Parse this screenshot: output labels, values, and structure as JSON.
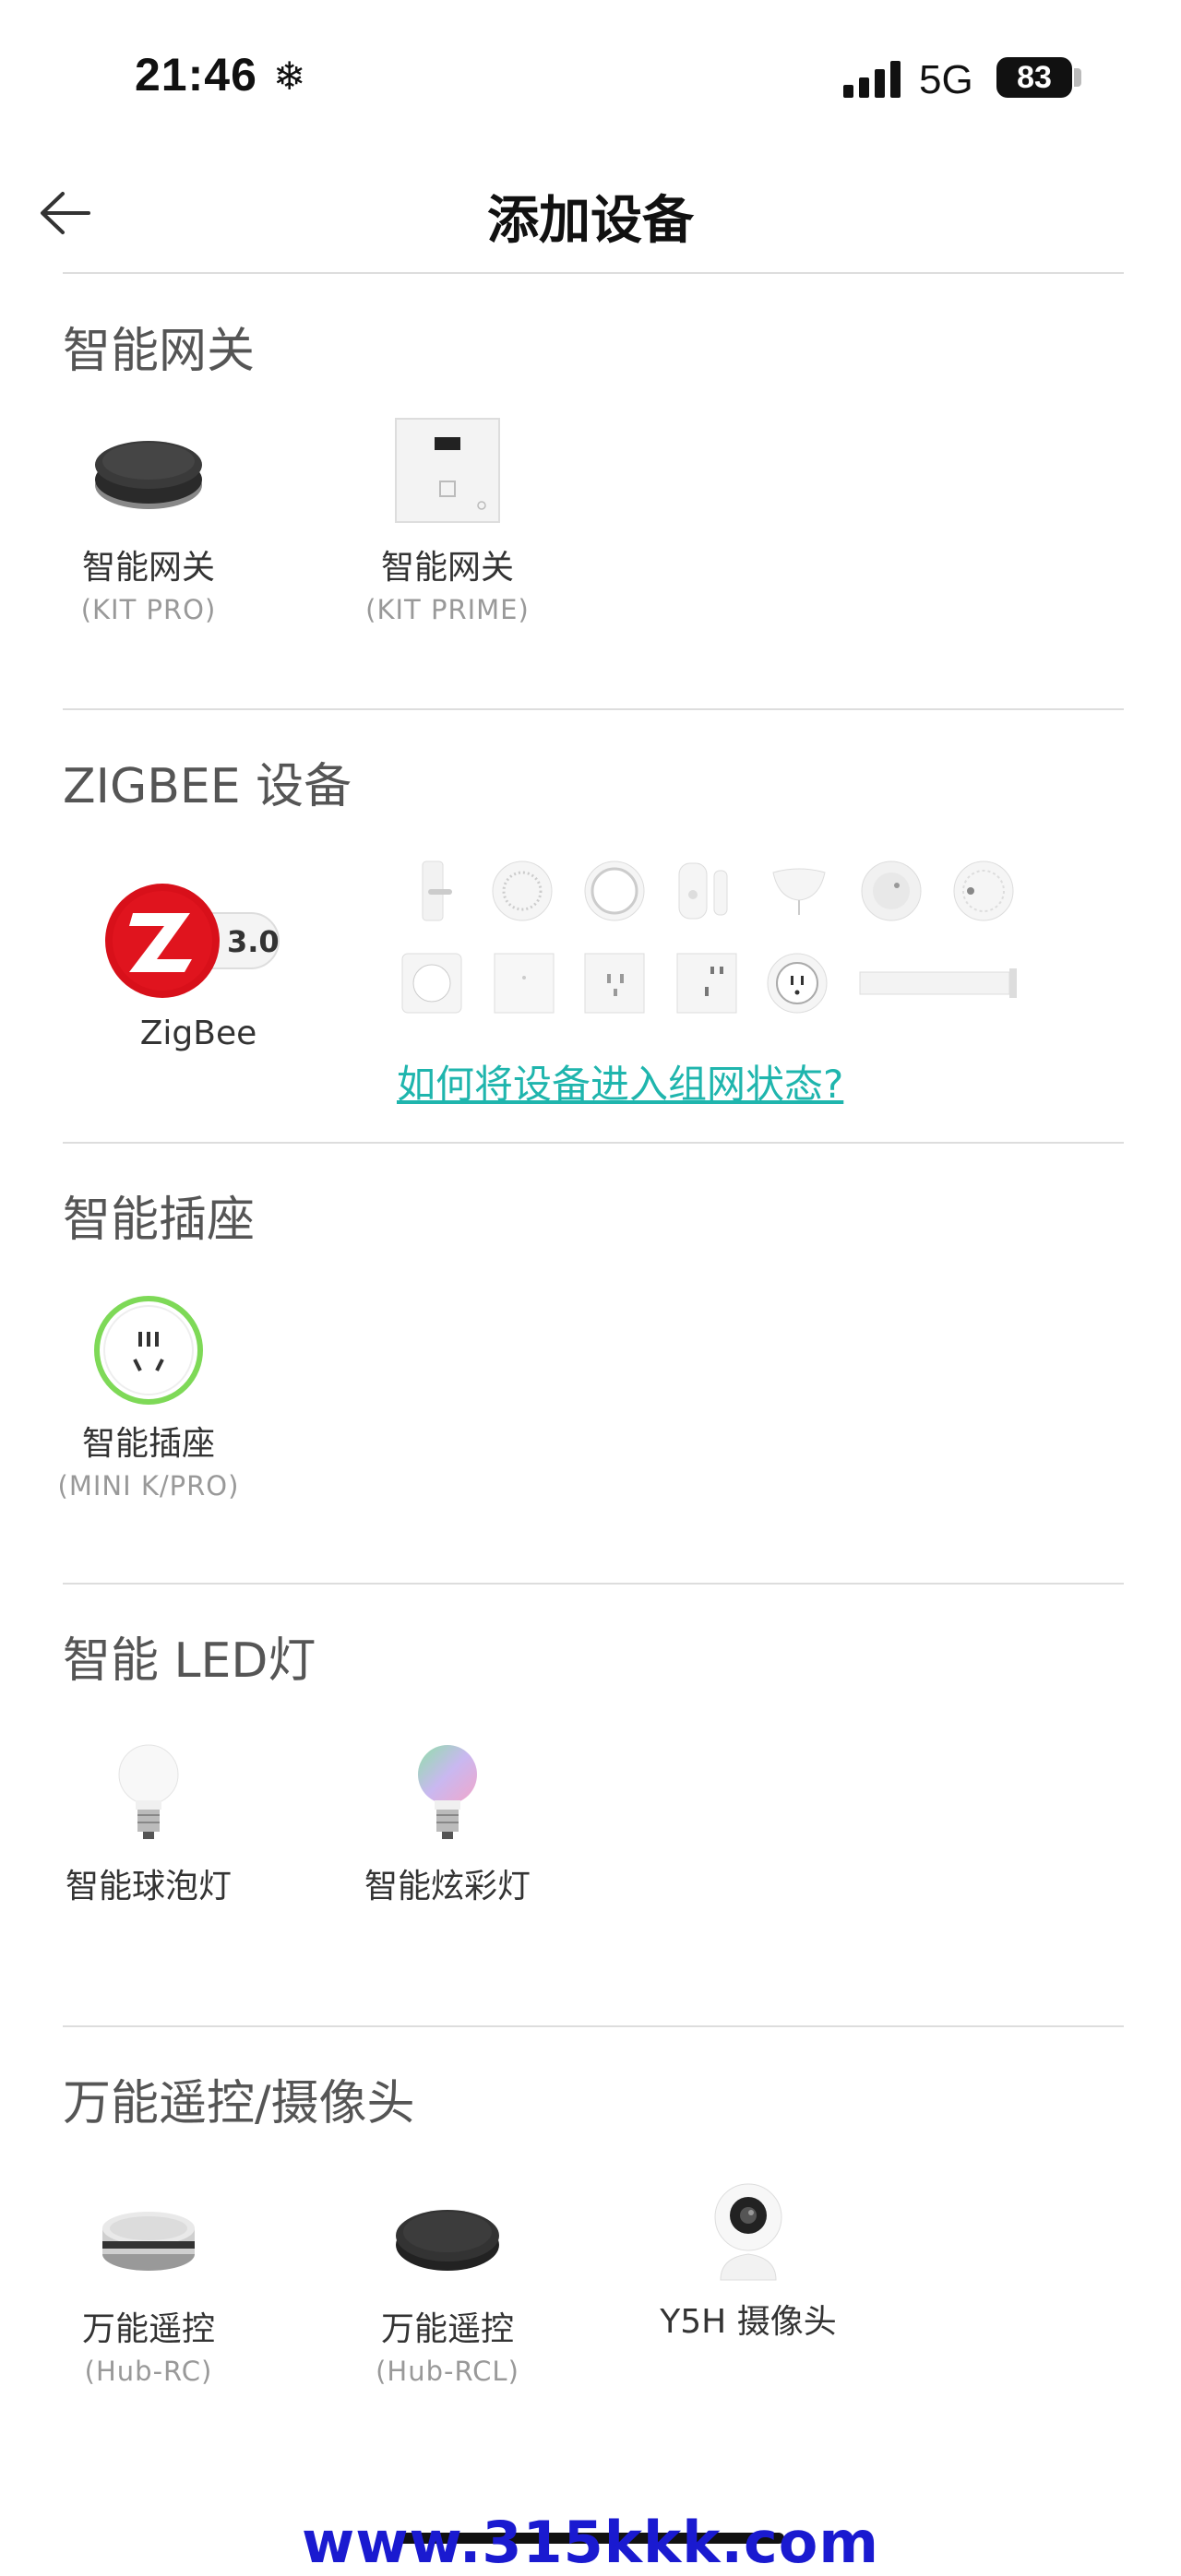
{
  "status_bar": {
    "time": "21:46",
    "network": "5G",
    "battery": "83"
  },
  "nav": {
    "title": "添加设备",
    "back_icon": "arrow-left-icon"
  },
  "sections": [
    {
      "title": "智能网关",
      "devices": [
        {
          "name": "智能网关",
          "model": "(KIT PRO)",
          "icon": "round-gateway-icon"
        },
        {
          "name": "智能网关",
          "model": "(KIT PRIME)",
          "icon": "wall-panel-gateway-icon"
        }
      ]
    },
    {
      "title": "ZIGBEE 设备",
      "devices": [
        {
          "name": "ZigBee",
          "badge": "3.0",
          "icon": "zigbee-logo-icon"
        }
      ],
      "link": "如何将设备进入组网状态?"
    },
    {
      "title": "智能插座",
      "devices": [
        {
          "name": "智能插座",
          "model": "(MINI K/PRO)",
          "icon": "smart-plug-icon"
        }
      ]
    },
    {
      "title": "智能 LED灯",
      "devices": [
        {
          "name": "智能球泡灯",
          "icon": "white-bulb-icon"
        },
        {
          "name": "智能炫彩灯",
          "icon": "rgb-bulb-icon"
        }
      ]
    },
    {
      "title": "万能遥控/摄像头",
      "devices": [
        {
          "name": "万能遥控",
          "model": "(Hub-RC)",
          "icon": "silver-remote-hub-icon"
        },
        {
          "name": "万能遥控",
          "model": "(Hub-RCL)",
          "icon": "black-remote-hub-icon"
        },
        {
          "name": "Y5H 摄像头",
          "icon": "camera-icon"
        }
      ]
    }
  ],
  "watermark": "www.315kkk.com",
  "colors": {
    "link": "#1fb5ad",
    "zigbee_red": "#d8101a",
    "plug_green": "#7ed957"
  }
}
